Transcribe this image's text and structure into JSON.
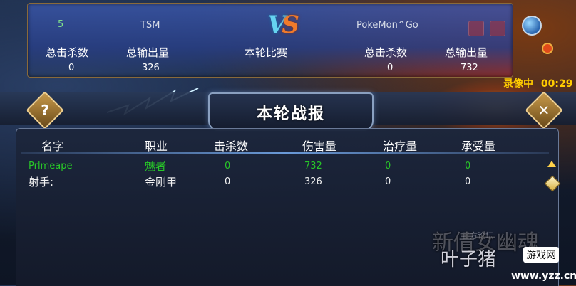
{
  "score": {
    "left_team": {
      "score": "5",
      "name": "TSM",
      "kills_label": "总击杀数",
      "kills": "0",
      "damage_label": "总输出量",
      "damage": "326"
    },
    "match_label": "本轮比赛",
    "vs_text": {
      "v": "V",
      "s": "S"
    },
    "right_team": {
      "score": "",
      "name": "PokeMon^Go",
      "kills_label": "总击杀数",
      "kills": "0",
      "damage_label": "总输出量",
      "damage": "732"
    }
  },
  "recording": {
    "label": "录像中",
    "time": "00:29"
  },
  "report": {
    "title": "本轮战报",
    "help_icon": "question-icon",
    "close_icon": "close-icon",
    "columns": [
      "名字",
      "职业",
      "击杀数",
      "伤害量",
      "治疗量",
      "承受量"
    ],
    "rows": [
      {
        "name": "Prlmeape",
        "job": "魅者",
        "kills": "0",
        "damage": "732",
        "heal": "0",
        "taken": "0"
      },
      {
        "name": "射手:",
        "job": "金刚甲",
        "kills": "0",
        "damage": "326",
        "heal": "0",
        "taken": "0"
      }
    ]
  },
  "watermark": {
    "forum": "官方论坛",
    "brand": "新倩女幽魂",
    "site_cn": "叶子猪",
    "badge": "游戏网",
    "url": "www.yzz.cn"
  },
  "colors": {
    "player_row": "#28c828",
    "recording": "#ffcc00",
    "accent_blue": "#66d3f0",
    "accent_orange": "#f07a2a"
  }
}
